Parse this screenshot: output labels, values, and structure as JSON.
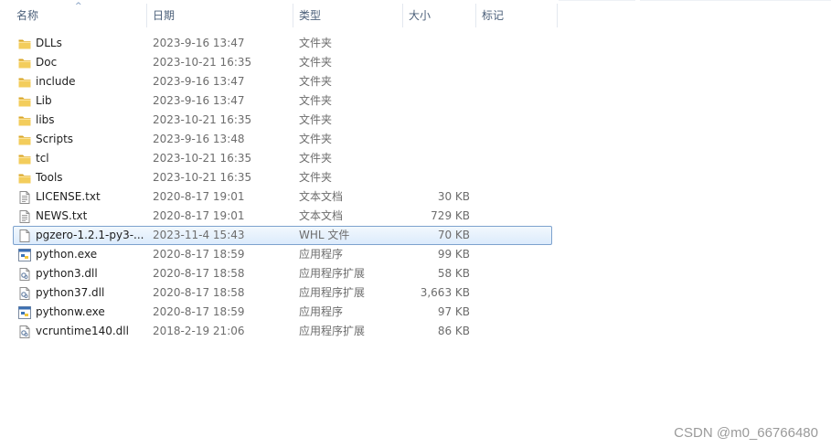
{
  "columns": {
    "name": "名称",
    "date": "日期",
    "type": "类型",
    "size": "大小",
    "tag": "标记"
  },
  "sort_indicator": "^",
  "files": [
    {
      "name": "DLLs",
      "date": "2023-9-16 13:47",
      "type": "文件夹",
      "size": "",
      "icon": "folder-icon",
      "selected": false
    },
    {
      "name": "Doc",
      "date": "2023-10-21 16:35",
      "type": "文件夹",
      "size": "",
      "icon": "folder-icon",
      "selected": false
    },
    {
      "name": "include",
      "date": "2023-9-16 13:47",
      "type": "文件夹",
      "size": "",
      "icon": "folder-icon",
      "selected": false
    },
    {
      "name": "Lib",
      "date": "2023-9-16 13:47",
      "type": "文件夹",
      "size": "",
      "icon": "folder-icon",
      "selected": false
    },
    {
      "name": "libs",
      "date": "2023-10-21 16:35",
      "type": "文件夹",
      "size": "",
      "icon": "folder-icon",
      "selected": false
    },
    {
      "name": "Scripts",
      "date": "2023-9-16 13:48",
      "type": "文件夹",
      "size": "",
      "icon": "folder-icon",
      "selected": false
    },
    {
      "name": "tcl",
      "date": "2023-10-21 16:35",
      "type": "文件夹",
      "size": "",
      "icon": "folder-icon",
      "selected": false
    },
    {
      "name": "Tools",
      "date": "2023-10-21 16:35",
      "type": "文件夹",
      "size": "",
      "icon": "folder-icon",
      "selected": false
    },
    {
      "name": "LICENSE.txt",
      "date": "2020-8-17 19:01",
      "type": "文本文档",
      "size": "30 KB",
      "icon": "text-file-icon",
      "selected": false
    },
    {
      "name": "NEWS.txt",
      "date": "2020-8-17 19:01",
      "type": "文本文档",
      "size": "729 KB",
      "icon": "text-file-icon",
      "selected": false
    },
    {
      "name": "pgzero-1.2.1-py3-...",
      "date": "2023-11-4 15:43",
      "type": "WHL 文件",
      "size": "70 KB",
      "icon": "blank-file-icon",
      "selected": true
    },
    {
      "name": "python.exe",
      "date": "2020-8-17 18:59",
      "type": "应用程序",
      "size": "99 KB",
      "icon": "python-exe-icon",
      "selected": false
    },
    {
      "name": "python3.dll",
      "date": "2020-8-17 18:58",
      "type": "应用程序扩展",
      "size": "58 KB",
      "icon": "dll-file-icon",
      "selected": false
    },
    {
      "name": "python37.dll",
      "date": "2020-8-17 18:58",
      "type": "应用程序扩展",
      "size": "3,663 KB",
      "icon": "dll-file-icon",
      "selected": false
    },
    {
      "name": "pythonw.exe",
      "date": "2020-8-17 18:59",
      "type": "应用程序",
      "size": "97 KB",
      "icon": "python-exe-icon",
      "selected": false
    },
    {
      "name": "vcruntime140.dll",
      "date": "2018-2-19 21:06",
      "type": "应用程序扩展",
      "size": "86 KB",
      "icon": "dll-file-icon",
      "selected": false
    }
  ],
  "colors": {
    "selection_border": "#7da2ce",
    "selection_fill": "#dcebfc",
    "folder": "#e8b940",
    "header_text": "#4c607a"
  },
  "watermark": "CSDN @m0_66766480"
}
